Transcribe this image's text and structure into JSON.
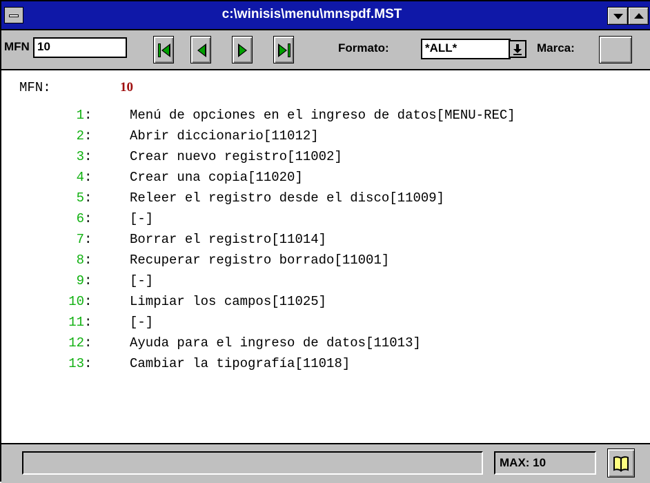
{
  "window": {
    "title": "c:\\winisis\\menu\\mnspdf.MST"
  },
  "toolbar": {
    "mfn_label": "MFN",
    "mfn_value": "10",
    "formato_label": "Formato:",
    "formato_value": "*ALL*",
    "marca_label": "Marca:",
    "nav_buttons": [
      "first-record",
      "previous-record",
      "next-record",
      "last-record"
    ]
  },
  "record": {
    "mfn_label": "MFN:",
    "mfn_value": "10",
    "lines": [
      {
        "num": "1",
        "text": "Menú de opciones en el ingreso de datos[MENU-REC]"
      },
      {
        "num": "2",
        "text": "Abrir diccionario[11012]"
      },
      {
        "num": "3",
        "text": "Crear nuevo registro[11002]"
      },
      {
        "num": "4",
        "text": "Crear una copia[11020]"
      },
      {
        "num": "5",
        "text": "Releer el registro desde el disco[11009]"
      },
      {
        "num": "6",
        "text": "[-]"
      },
      {
        "num": "7",
        "text": "Borrar el registro[11014]"
      },
      {
        "num": "8",
        "text": "Recuperar registro borrado[11001]"
      },
      {
        "num": "9",
        "text": "[-]"
      },
      {
        "num": "10",
        "text": "Limpiar los campos[11025]"
      },
      {
        "num": "11",
        "text": "[-]"
      },
      {
        "num": "12",
        "text": "Ayuda para el ingreso de datos[11013]"
      },
      {
        "num": "13",
        "text": "Cambiar la tipografía[11018]"
      }
    ]
  },
  "status": {
    "message": "",
    "max_label": "MAX: 10"
  },
  "colors": {
    "titlebar": "#0f18a8",
    "line_numbers": "#10b010",
    "mfn_value": "#a01010",
    "chrome": "#c0c0c0"
  }
}
